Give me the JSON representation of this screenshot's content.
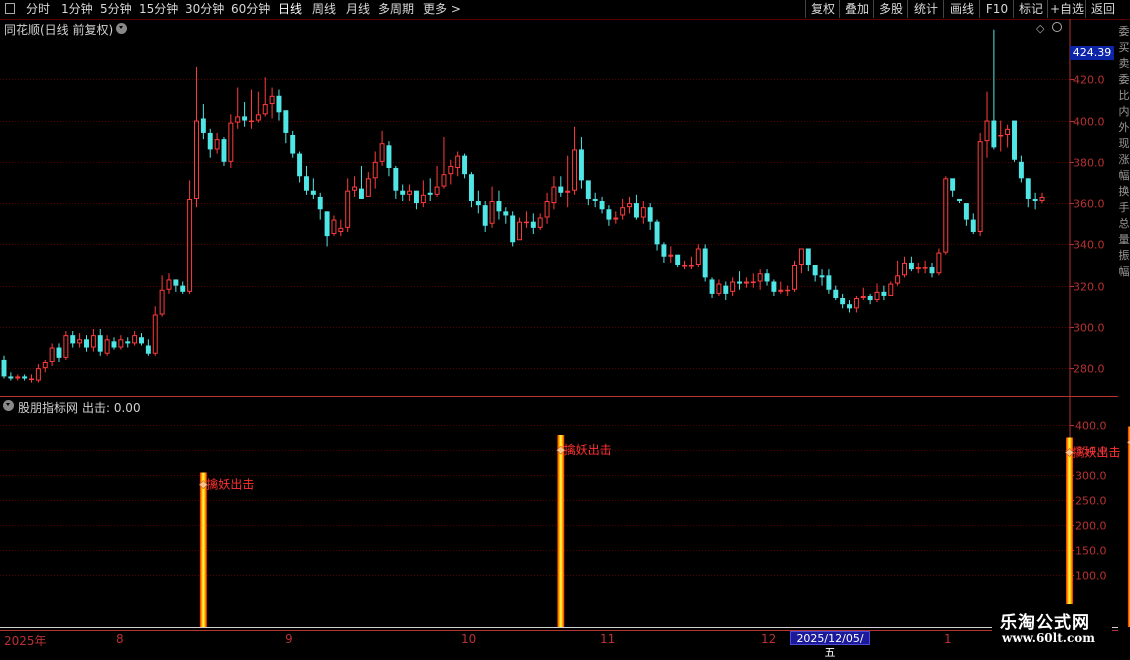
{
  "toolbar": {
    "periods": [
      "分时",
      "1分钟",
      "5分钟",
      "15分钟",
      "30分钟",
      "60分钟",
      "日线",
      "周线",
      "月线",
      "多周期",
      "更多 >"
    ],
    "active_period": "日线",
    "right_buttons": [
      "复权",
      "叠加",
      "多股",
      "统计",
      "画线",
      "F10",
      "标记",
      "+自选",
      "返回"
    ]
  },
  "main_chart": {
    "title": "同花顺(日线 前复权)",
    "current_price": "424.39",
    "y_labels": [
      "420.0",
      "400.0",
      "380.0",
      "360.0",
      "340.0",
      "320.0",
      "300.0",
      "280.0"
    ]
  },
  "indicator": {
    "title": "股朋指标网",
    "value_label": "出击: 0.00",
    "y_labels": [
      "400.0",
      "350.0",
      "300.0",
      "250.0",
      "200.0",
      "150.0",
      "100.0"
    ]
  },
  "x_axis": {
    "labels": [
      "2025年",
      "8",
      "9",
      "10",
      "11",
      "12",
      "1"
    ],
    "cursor_date": "2025/12/05/五"
  },
  "watermark": {
    "title": "乐淘公式网",
    "url": "www.60lt.com"
  },
  "right_panel_text": [
    "委",
    "买",
    "卖",
    "委",
    "比",
    "内",
    "外",
    "现",
    "涨",
    "幅",
    "换",
    "手",
    "总",
    "量",
    "振",
    "幅"
  ],
  "colors": {
    "up": "#ff3c3c",
    "down": "#50e6e6",
    "grid": "#5a0000",
    "axis_text": "#b83232",
    "signal": "#ffd800"
  },
  "chart_data": {
    "type": "candlestick",
    "candles": [
      [
        284,
        276,
        286,
        275
      ],
      [
        276,
        275,
        278,
        274
      ],
      [
        275,
        276,
        277,
        274
      ],
      [
        276,
        275,
        277,
        274
      ],
      [
        275,
        275,
        277,
        273
      ],
      [
        274,
        280,
        282,
        273
      ],
      [
        280,
        283,
        284,
        278
      ],
      [
        283,
        290,
        292,
        281
      ],
      [
        290,
        285,
        292,
        283
      ],
      [
        285,
        296,
        298,
        284
      ],
      [
        296,
        292,
        298,
        290
      ],
      [
        292,
        294,
        297,
        290
      ],
      [
        294,
        290,
        296,
        288
      ],
      [
        290,
        296,
        299,
        288
      ],
      [
        296,
        288,
        299,
        286
      ],
      [
        287,
        294,
        296,
        286
      ],
      [
        293,
        290,
        295,
        289
      ],
      [
        290,
        294,
        296,
        289
      ],
      [
        293,
        292,
        295,
        290
      ],
      [
        292,
        296,
        298,
        291
      ],
      [
        295,
        292,
        297,
        291
      ],
      [
        291,
        287,
        294,
        286
      ],
      [
        287,
        306,
        310,
        286
      ],
      [
        306,
        318,
        325,
        305
      ],
      [
        318,
        323,
        326,
        316
      ],
      [
        323,
        320,
        323,
        317
      ],
      [
        320,
        317,
        322,
        316
      ],
      [
        317,
        362,
        371,
        316
      ],
      [
        362,
        400,
        426,
        358
      ],
      [
        401,
        394,
        408,
        391
      ],
      [
        394,
        386,
        396,
        382
      ],
      [
        386,
        391,
        394,
        384
      ],
      [
        391,
        380,
        392,
        378
      ],
      [
        380,
        399,
        403,
        377
      ],
      [
        399,
        402,
        416,
        396
      ],
      [
        402,
        400,
        409,
        397
      ],
      [
        400,
        400,
        415,
        396
      ],
      [
        400,
        403,
        414,
        399
      ],
      [
        403,
        408,
        421,
        402
      ],
      [
        408,
        412,
        416,
        401
      ],
      [
        412,
        404,
        415,
        400
      ],
      [
        405,
        394,
        404,
        389
      ],
      [
        393,
        384,
        395,
        382
      ],
      [
        384,
        373,
        385,
        370
      ],
      [
        373,
        366,
        378,
        364
      ],
      [
        366,
        364,
        372,
        362
      ],
      [
        363,
        357,
        365,
        352
      ],
      [
        356,
        344,
        356,
        339
      ],
      [
        345,
        352,
        354,
        344
      ],
      [
        346,
        348,
        352,
        344
      ],
      [
        348,
        366,
        372,
        346
      ],
      [
        366,
        368,
        373,
        363
      ],
      [
        367,
        362,
        378,
        362
      ],
      [
        363,
        372,
        375,
        365
      ],
      [
        372,
        380,
        385,
        367
      ],
      [
        380,
        389,
        395,
        378
      ],
      [
        388,
        377,
        390,
        373
      ],
      [
        377,
        366,
        378,
        362
      ],
      [
        366,
        364,
        369,
        361
      ],
      [
        364,
        366,
        369,
        361
      ],
      [
        366,
        360,
        366,
        357
      ],
      [
        360,
        364,
        371,
        358
      ],
      [
        365,
        364,
        372,
        361
      ],
      [
        364,
        368,
        378,
        363
      ],
      [
        368,
        374,
        392,
        367
      ],
      [
        374,
        378,
        381,
        369
      ],
      [
        377,
        383,
        385,
        373
      ],
      [
        383,
        374,
        384,
        372
      ],
      [
        374,
        361,
        375,
        358
      ],
      [
        361,
        359,
        366,
        355
      ],
      [
        359,
        349,
        361,
        346
      ],
      [
        350,
        361,
        368,
        348
      ],
      [
        361,
        356,
        366,
        352
      ],
      [
        356,
        354,
        358,
        350
      ],
      [
        354,
        341,
        356,
        339
      ],
      [
        342,
        351,
        353,
        343
      ],
      [
        351,
        351,
        356,
        348
      ],
      [
        351,
        348,
        355,
        345
      ],
      [
        348,
        353,
        355,
        347
      ],
      [
        353,
        361,
        365,
        350
      ],
      [
        360,
        368,
        373,
        357
      ],
      [
        368,
        365,
        373,
        363
      ],
      [
        365,
        366,
        383,
        358
      ],
      [
        366,
        386,
        397,
        364
      ],
      [
        386,
        371,
        392,
        367
      ],
      [
        371,
        362,
        369,
        359
      ],
      [
        362,
        361,
        365,
        358
      ],
      [
        361,
        357,
        363,
        355
      ],
      [
        357,
        352,
        359,
        349
      ],
      [
        352,
        353,
        356,
        350
      ],
      [
        354,
        358,
        362,
        352
      ],
      [
        358,
        360,
        363,
        355
      ],
      [
        360,
        353,
        364,
        352
      ],
      [
        353,
        358,
        361,
        350
      ],
      [
        358,
        351,
        360,
        347
      ],
      [
        351,
        340,
        352,
        337
      ],
      [
        340,
        334,
        341,
        331
      ],
      [
        334,
        335,
        339,
        331
      ],
      [
        335,
        330,
        333,
        329
      ],
      [
        330,
        330,
        332,
        328
      ],
      [
        330,
        330,
        334,
        328
      ],
      [
        330,
        338,
        340,
        329
      ],
      [
        338,
        324,
        340,
        322
      ],
      [
        323,
        316,
        324,
        314
      ],
      [
        316,
        321,
        323,
        315
      ],
      [
        320,
        316,
        322,
        313
      ],
      [
        317,
        322,
        324,
        315
      ],
      [
        322,
        321,
        327,
        318
      ],
      [
        321,
        322,
        324,
        319
      ],
      [
        322,
        322,
        326,
        319
      ],
      [
        322,
        326,
        328,
        318
      ],
      [
        326,
        322,
        328,
        320
      ],
      [
        322,
        317,
        323,
        315
      ],
      [
        317,
        318,
        322,
        316
      ],
      [
        318,
        318,
        320,
        315
      ],
      [
        318,
        330,
        332,
        317
      ],
      [
        330,
        338,
        338,
        326
      ],
      [
        338,
        330,
        334,
        327
      ],
      [
        330,
        325,
        328,
        322
      ],
      [
        325,
        324,
        328,
        320
      ],
      [
        325,
        318,
        328,
        316
      ],
      [
        318,
        314,
        320,
        313
      ],
      [
        314,
        311,
        316,
        309
      ],
      [
        311,
        309,
        313,
        307
      ],
      [
        309,
        314,
        315,
        307
      ],
      [
        314,
        315,
        319,
        313
      ],
      [
        315,
        313,
        316,
        311
      ],
      [
        313,
        317,
        321,
        312
      ],
      [
        317,
        315,
        320,
        313
      ],
      [
        315,
        321,
        322,
        315
      ],
      [
        321,
        325,
        332,
        320
      ],
      [
        325,
        331,
        334,
        324
      ],
      [
        331,
        328,
        334,
        327
      ],
      [
        328,
        329,
        331,
        326
      ],
      [
        329,
        329,
        332,
        326
      ],
      [
        329,
        326,
        331,
        324
      ],
      [
        326,
        336,
        338,
        325
      ],
      [
        336,
        372,
        373,
        335
      ],
      [
        372,
        366,
        371,
        363
      ],
      [
        362,
        361,
        361,
        360
      ],
      [
        360,
        352,
        360,
        349
      ],
      [
        352,
        346,
        355,
        345
      ],
      [
        346,
        390,
        394,
        344
      ],
      [
        390,
        400,
        414,
        382
      ],
      [
        400,
        387,
        444,
        386
      ],
      [
        393,
        393,
        400,
        385
      ],
      [
        393,
        396,
        398,
        387
      ],
      [
        400,
        381,
        399,
        380
      ],
      [
        380,
        372,
        383,
        370
      ],
      [
        372,
        362,
        372,
        358
      ],
      [
        362,
        361,
        365,
        357
      ],
      [
        361,
        363,
        365,
        360
      ]
    ],
    "signals": [
      {
        "label": "擒妖出击",
        "value": 305
      },
      {
        "label": "擒妖出击",
        "value": 380
      },
      {
        "label": "擒妖出击",
        "value": 375
      },
      {
        "label": "擒妖出击",
        "value": 397
      }
    ],
    "price_axis_range": [
      267,
      440
    ],
    "indicator_axis_range": [
      0,
      420
    ]
  }
}
